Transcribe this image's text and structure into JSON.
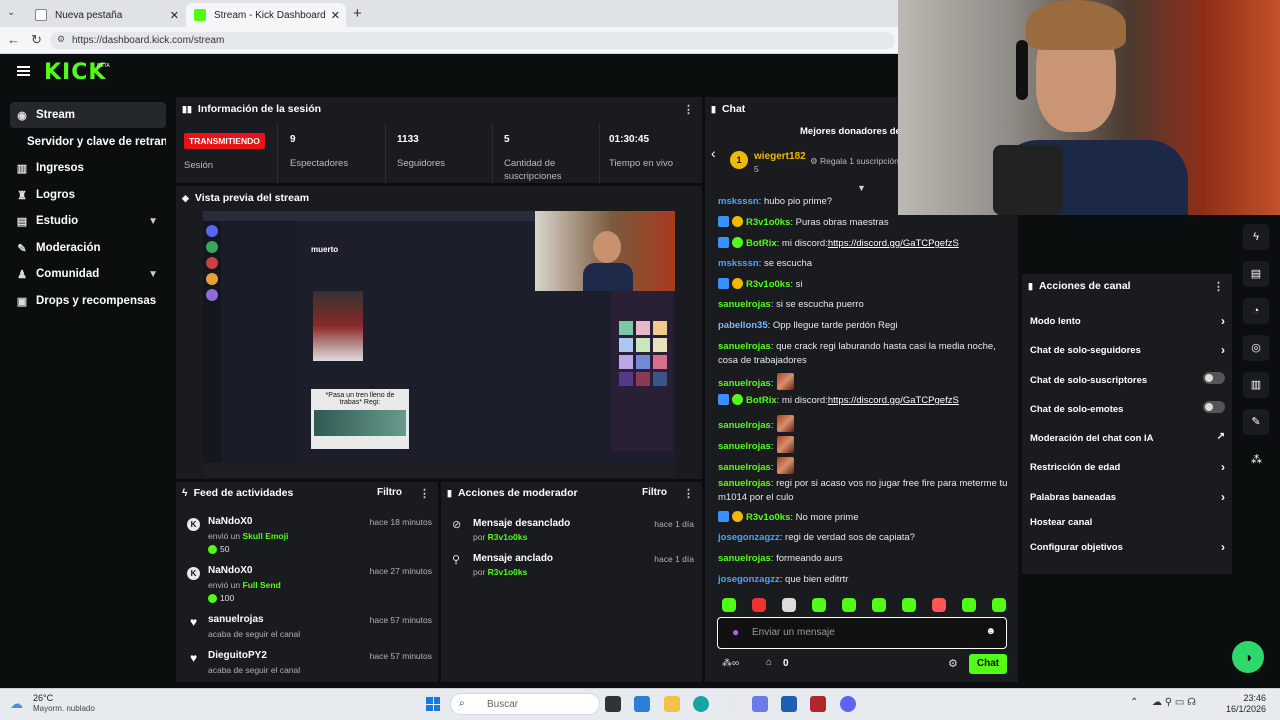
{
  "browser": {
    "tabs": [
      {
        "label": "Nueva pestaña"
      },
      {
        "label": "Stream - Kick Dashboard"
      }
    ],
    "url": "https://dashboard.kick.com/stream"
  },
  "header": {
    "logo": "KICK",
    "beta": "BETA"
  },
  "sidebar": {
    "items": [
      {
        "label": "Stream"
      },
      {
        "label": "Servidor y clave de retransmisión"
      },
      {
        "label": "Ingresos"
      },
      {
        "label": "Logros"
      },
      {
        "label": "Estudio"
      },
      {
        "label": "Moderación"
      },
      {
        "label": "Comunidad"
      },
      {
        "label": "Drops y recompensas"
      }
    ]
  },
  "session": {
    "title": "Información de la sesión",
    "status": "TRANSMITIENDO",
    "status_label": "Sesión",
    "stats": [
      {
        "value": "9",
        "label": "Espectadores"
      },
      {
        "value": "1133",
        "label": "Seguidores"
      },
      {
        "value": "5",
        "label": "Cantidad de suscripciones"
      },
      {
        "value": "01:30:45",
        "label": "Tiempo en vivo"
      }
    ]
  },
  "preview": {
    "title": "Vista previa del stream",
    "discord_title": "muerto",
    "discord_card": "*Pasa un tren lleno de trabas* Regi:"
  },
  "feed": {
    "title": "Feed de actividades",
    "filter": "Filtro",
    "items": [
      {
        "name": "NaNdoX0",
        "time": "hace 18 minutos",
        "desc": "envió un",
        "item": "Skull Emoji",
        "amount": "50"
      },
      {
        "name": "NaNdoX0",
        "time": "hace 27 minutos",
        "desc": "envió un",
        "item": "Full Send",
        "amount": "100"
      },
      {
        "name": "sanuelrojas",
        "time": "hace 57 minutos",
        "desc": "acaba de seguir el canal"
      },
      {
        "name": "DieguitoPY2",
        "time": "hace 57 minutos",
        "desc": "acaba de seguir el canal"
      }
    ]
  },
  "mod_actions": {
    "title": "Acciones de moderador",
    "filter": "Filtro",
    "items": [
      {
        "name": "Mensaje desanclado",
        "time": "hace 1 día",
        "by": "por",
        "user": "R3v1o0ks"
      },
      {
        "name": "Mensaje anclado",
        "time": "hace 1 día",
        "by": "por",
        "user": "R3v1o0ks"
      }
    ]
  },
  "chat": {
    "title": "Chat",
    "donors_title": "Mejores donadores de",
    "donor": {
      "name": "wiegert182",
      "count": "5",
      "gift": "Regala 1 suscripción"
    },
    "messages": [
      {
        "user": "msksssn",
        "color": "#4aa3ff",
        "text": ": hubo pio prime?"
      },
      {
        "user": "R3v1o0ks",
        "color": "#53fc18",
        "text": ": Puras obras maestras"
      },
      {
        "user": "BotRix",
        "color": "#53fc18",
        "text": ": mi discord:",
        "link": "https://discord.gg/GaTCPgefzS"
      },
      {
        "user": "msksssn",
        "color": "#4aa3ff",
        "text": ": se escucha"
      },
      {
        "user": "R3v1o0ks",
        "color": "#53fc18",
        "text": ": si"
      },
      {
        "user": "sanuelrojas",
        "color": "#53fc18",
        "text": ": si se escucha puerro"
      },
      {
        "user": "pabellon35",
        "color": "#7db7ff",
        "text": ": Opp llegue tarde perdón Regi"
      },
      {
        "user": "sanuelrojas",
        "color": "#53fc18",
        "text": ": que crack regi laburando hasta casi la media noche, cosa de trabajadores"
      },
      {
        "user": "sanuelrojas",
        "color": "#53fc18",
        "text": ":"
      },
      {
        "user": "BotRix",
        "color": "#53fc18",
        "text": ": mi discord:",
        "link": "https://discord.gg/GaTCPgefzS"
      },
      {
        "user": "sanuelrojas",
        "color": "#53fc18",
        "text": ":"
      },
      {
        "user": "sanuelrojas",
        "color": "#53fc18",
        "text": ":"
      },
      {
        "user": "sanuelrojas",
        "color": "#53fc18",
        "text": ":"
      },
      {
        "user": "sanuelrojas",
        "color": "#53fc18",
        "text": ": regi por si acaso vos no jugar free fire para meterme tu m1014 por el culo"
      },
      {
        "user": "R3v1o0ks",
        "color": "#53fc18",
        "text": ": No more prime"
      },
      {
        "user": "josegonzagzz",
        "color": "#4aa3ff",
        "text": ": regi de verdad sos de capiata?"
      },
      {
        "user": "sanuelrojas",
        "color": "#53fc18",
        "text": ": formeando aurs"
      },
      {
        "user": "josegonzagzz",
        "color": "#4aa3ff",
        "text": ": que bien editrtr"
      }
    ],
    "input_placeholder": "Enviar un mensaje",
    "points": "0",
    "send": "Chat"
  },
  "channel_actions": {
    "title": "Acciones de canal",
    "items": [
      {
        "label": "Modo lento"
      },
      {
        "label": "Chat de solo-seguidores"
      },
      {
        "label": "Chat de solo-suscriptores"
      },
      {
        "label": "Chat de solo-emotes"
      },
      {
        "label": "Moderación del chat con IA"
      },
      {
        "label": "Restricción de edad"
      },
      {
        "label": "Palabras baneadas"
      },
      {
        "label": "Hostear canal"
      },
      {
        "label": "Configurar objetivos"
      }
    ]
  },
  "taskbar": {
    "temp": "26°C",
    "weather": "Mayorm. nublado",
    "search": "Buscar",
    "time": "23:46",
    "date": "16/1/2026"
  },
  "colors": {
    "accent": "#53fc18",
    "live": "#e3141a",
    "bg": "#0b0e0f",
    "panel": "#191b1f"
  }
}
